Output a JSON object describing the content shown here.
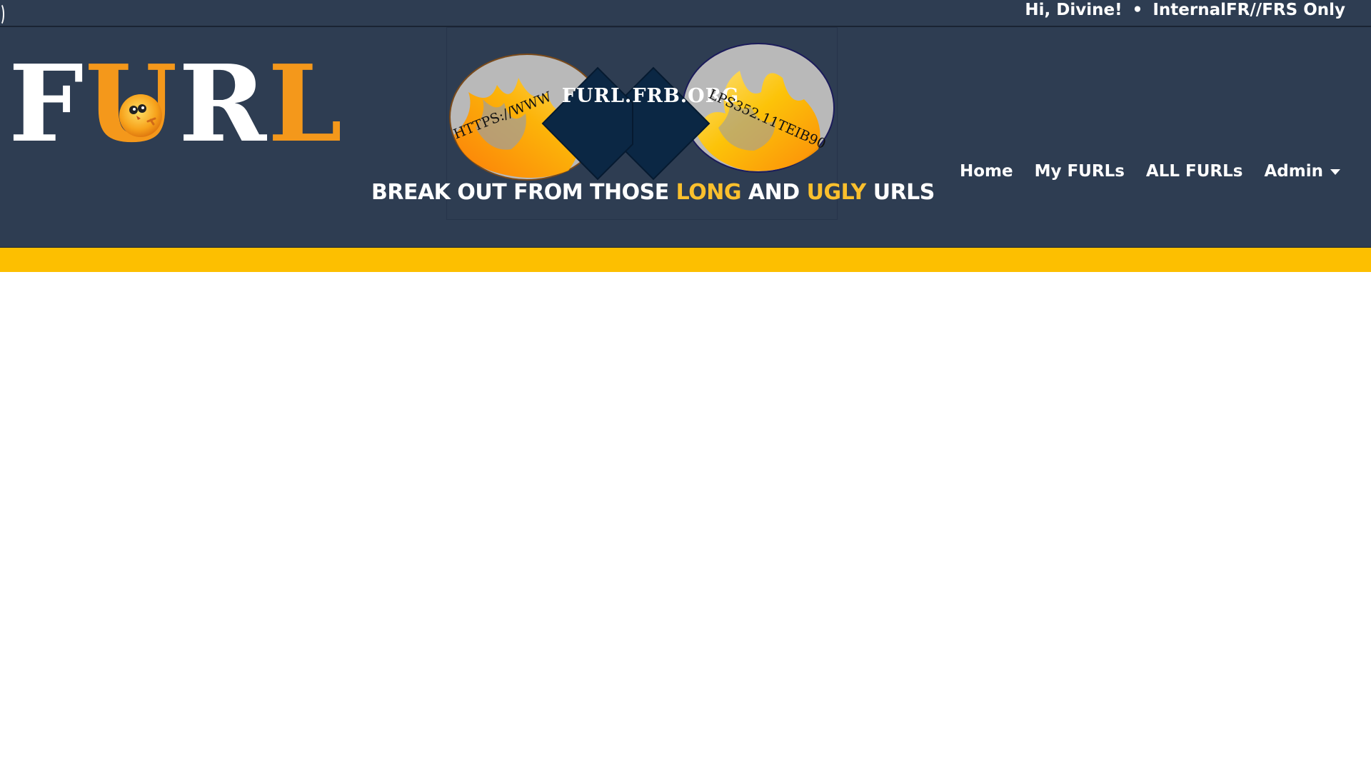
{
  "topbar": {
    "greeting": "Hi, Divine!",
    "separator": "•",
    "classification": "InternalFR//FRS Only"
  },
  "logo": {
    "letters": [
      "F",
      "U",
      "R",
      "L"
    ],
    "colors": {
      "white": "#ffffff",
      "orange": "#f4981b"
    }
  },
  "banner": {
    "center_text": "FURL.FRB.ORG",
    "left_arc_text": "HTTPS://WWW",
    "right_arc_text": "LPS352.11TEIB90"
  },
  "tagline": {
    "part1": "BREAK OUT FROM THOSE",
    "highlight1": "LONG",
    "part2": "AND",
    "highlight2": "UGLY",
    "part3": "URLS"
  },
  "nav": {
    "items": [
      {
        "label": "Home"
      },
      {
        "label": "My FURLs"
      },
      {
        "label": "ALL FURLs"
      },
      {
        "label": "Admin"
      }
    ]
  },
  "colors": {
    "header_bg": "#2e3d52",
    "accent_yellow": "#fdbf00",
    "banner_navy": "#0b2744"
  }
}
